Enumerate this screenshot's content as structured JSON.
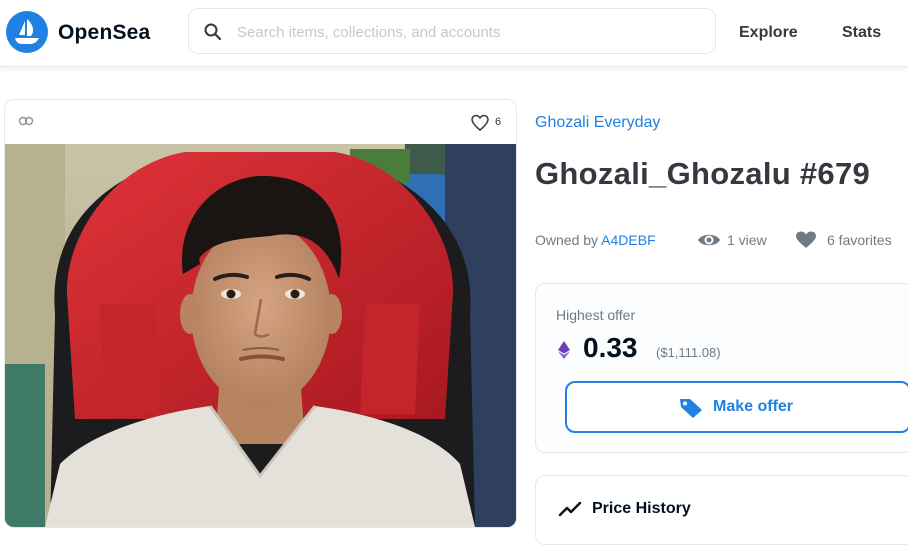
{
  "header": {
    "brand": "OpenSea",
    "search_placeholder": "Search items, collections, and accounts",
    "nav": [
      "Explore",
      "Stats"
    ]
  },
  "item_card": {
    "favorites_count": "6",
    "image_alt": "Portrait photo of a young man sitting in a red gaming chair"
  },
  "item": {
    "collection": "Ghozali Everyday",
    "title": "Ghozali_Ghozalu #679",
    "owned_by_label": "Owned by",
    "owner": "A4DEBF",
    "views": "1 view",
    "favorites": "6 favorites"
  },
  "offer": {
    "label": "Highest offer",
    "price": "0.33",
    "usd": "($1,111.08)",
    "button_label": "Make offer"
  },
  "history": {
    "label": "Price History"
  },
  "colors": {
    "accent": "#2081e2",
    "text": "#04111d",
    "muted": "#707a83"
  }
}
